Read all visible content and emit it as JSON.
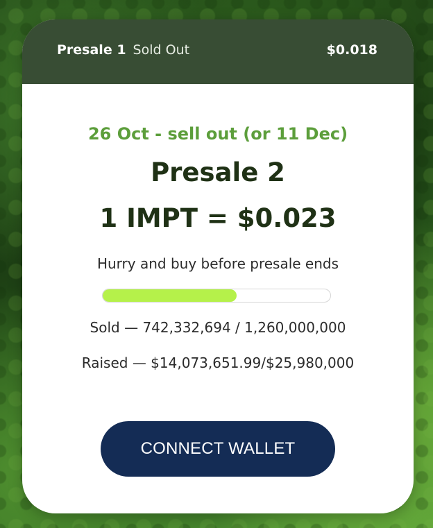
{
  "header": {
    "stage_label": "Presale 1",
    "stage_status": "Sold Out",
    "stage_price": "$0.018"
  },
  "presale": {
    "dates": "26 Oct - sell out (or 11 Dec)",
    "title": "Presale 2",
    "price_line": "1 IMPT = $0.023",
    "hurry_text": "Hurry and buy before presale ends",
    "progress_fraction": 0.589,
    "sold_text": "Sold — 742,332,694 / 1,260,000,000",
    "raised_text": "Raised — $14,073,651.99/$25,980,000"
  },
  "actions": {
    "connect_label": "CONNECT WALLET"
  },
  "colors": {
    "accent_green": "#5c9e3b",
    "progress_fill": "#b5f14a",
    "button_navy": "#142c55",
    "header_dark": "#1c3418"
  }
}
